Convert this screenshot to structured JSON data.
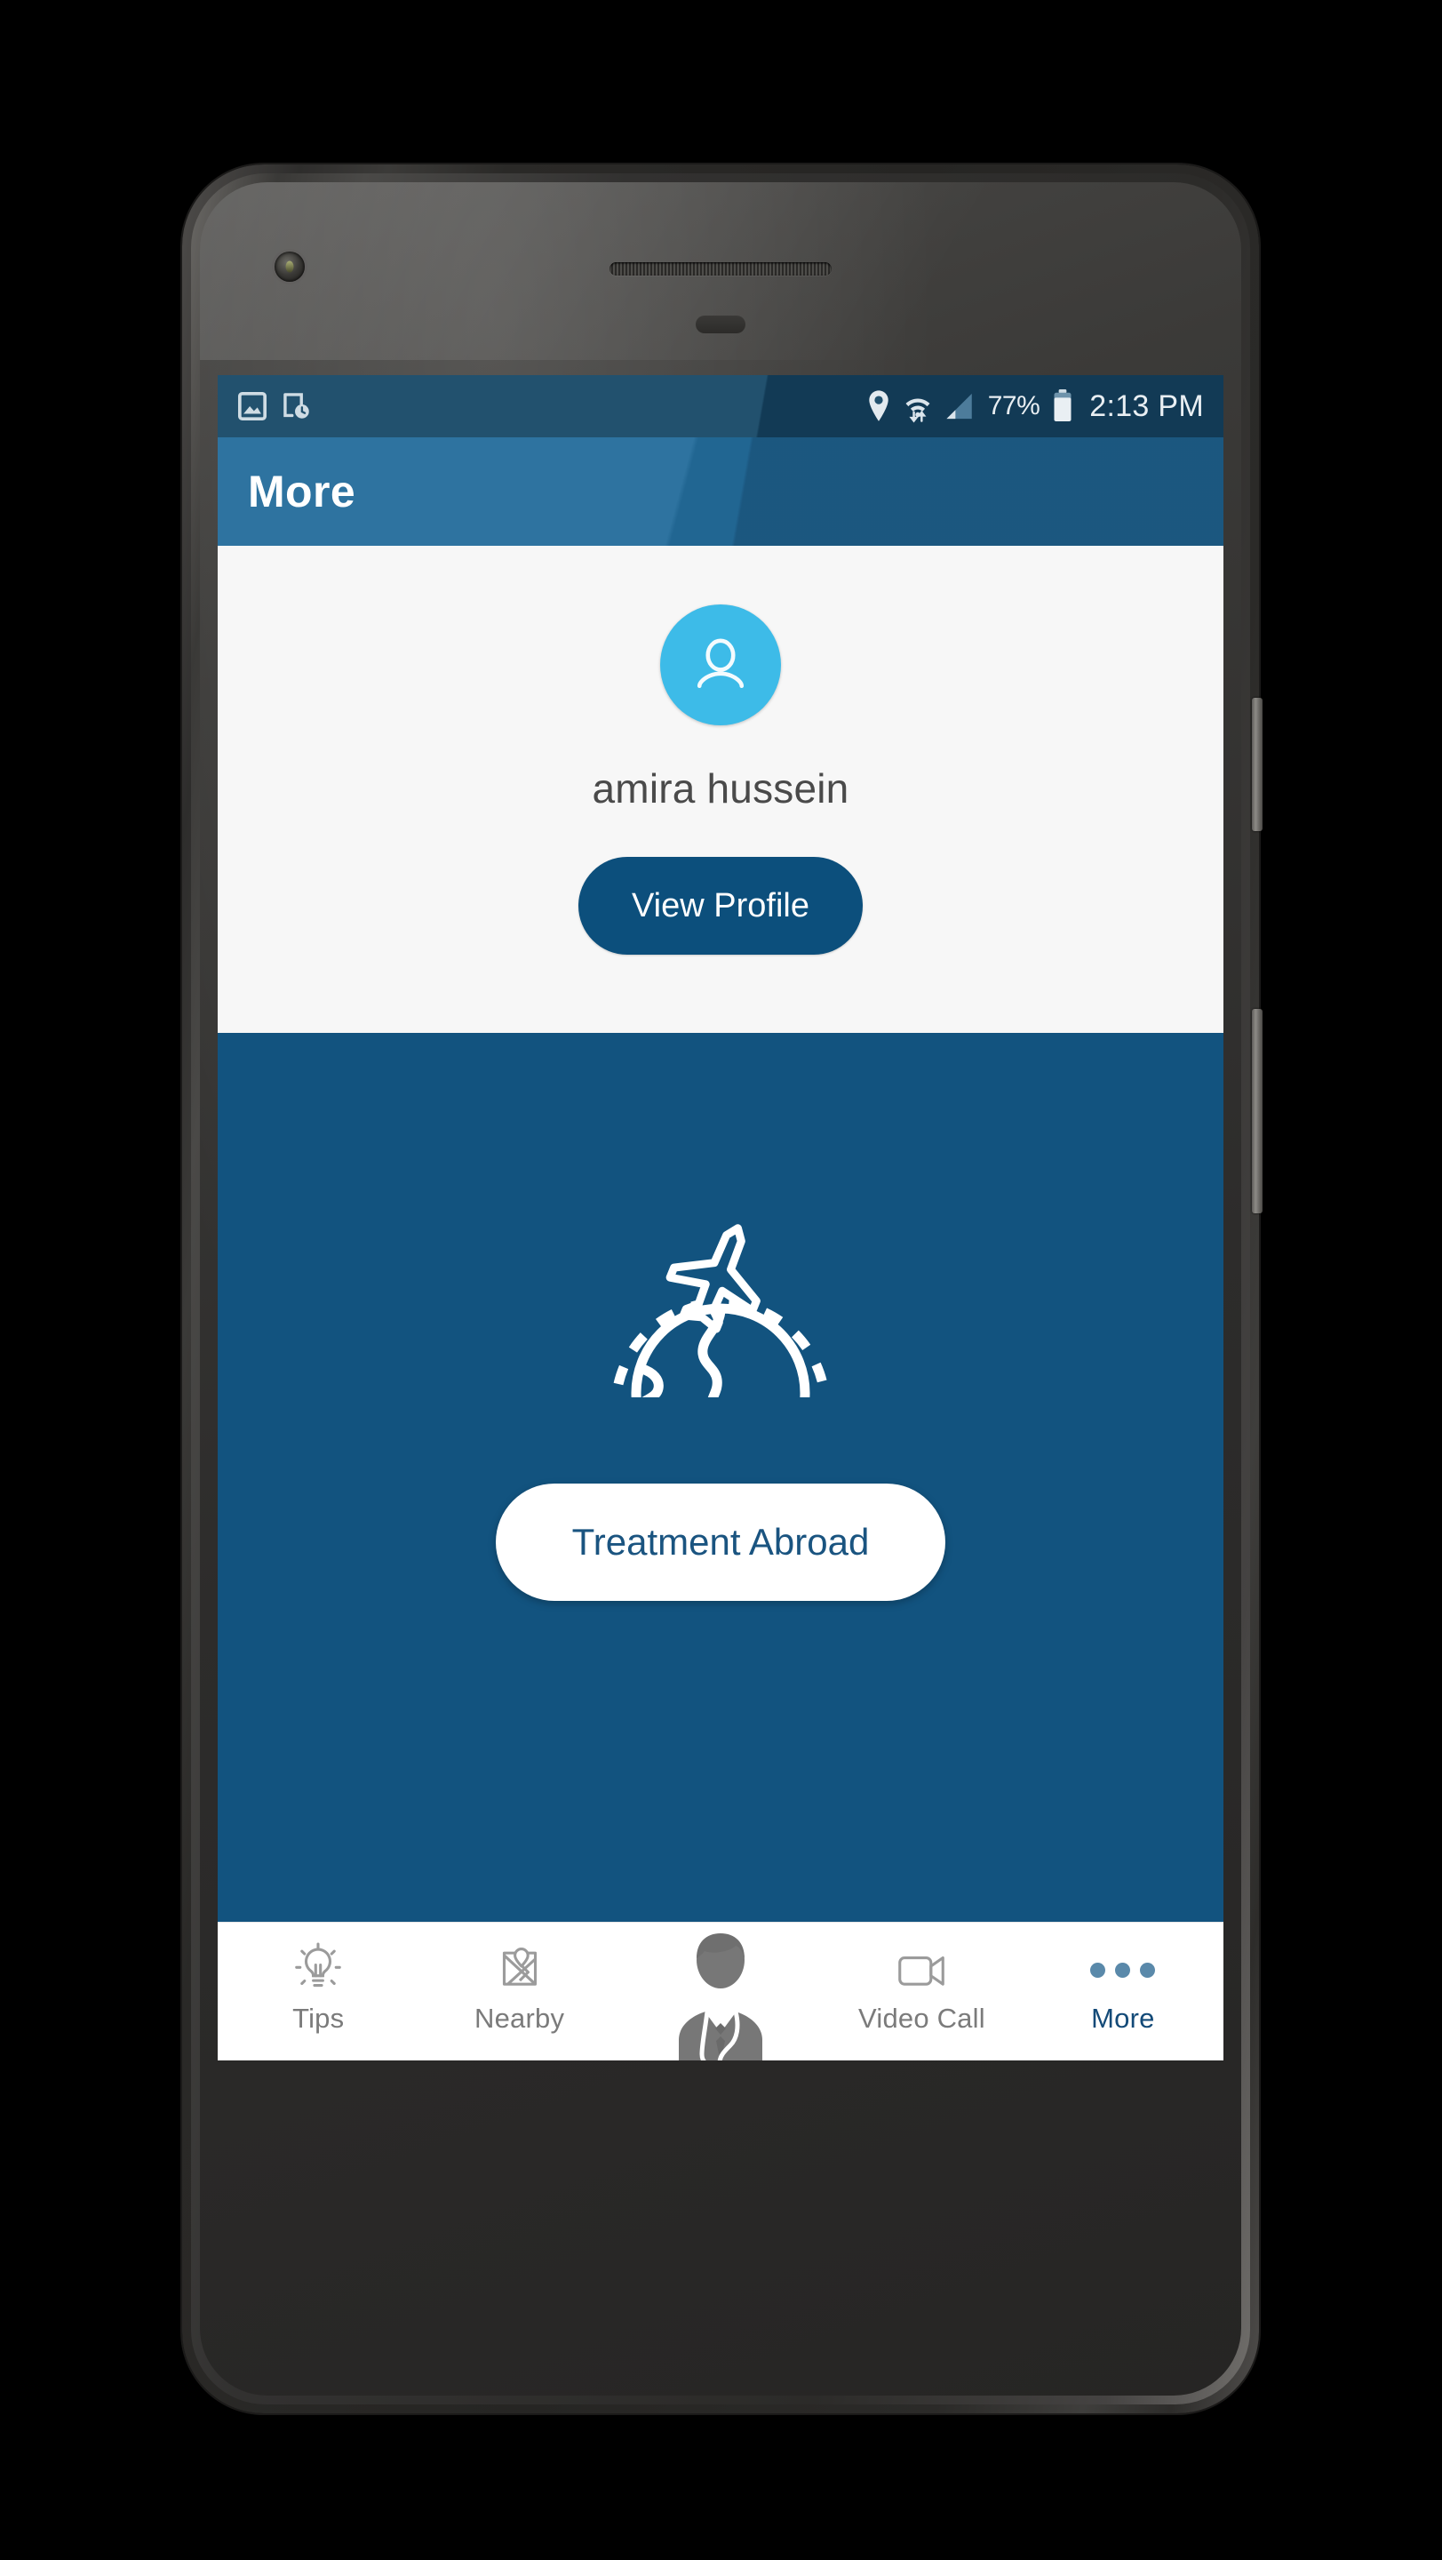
{
  "statusbar": {
    "left_icons": [
      "image-icon",
      "device-clock-icon"
    ],
    "right_icons": [
      "location-pin-icon",
      "wifi-icon",
      "cellular-signal-icon"
    ],
    "battery_percent": "77%",
    "battery_icon": "battery-icon",
    "time": "2:13 PM"
  },
  "appbar": {
    "title": "More"
  },
  "profile": {
    "avatar_icon": "person-avatar-icon",
    "name": "amira hussein",
    "view_profile_label": "View Profile"
  },
  "abroad": {
    "art_icon": "airplane-over-globe-icon",
    "button_label": "Treatment Abroad"
  },
  "bottomnav": {
    "items": [
      {
        "label": "Tips",
        "icon": "lightbulb-icon",
        "active": false
      },
      {
        "label": "Nearby",
        "icon": "map-pin-icon",
        "active": false
      },
      {
        "label": "",
        "icon": "doctor-icon",
        "active": false
      },
      {
        "label": "Video Call",
        "icon": "video-camera-icon",
        "active": false
      },
      {
        "label": "More",
        "icon": "three-dots-icon",
        "active": true
      }
    ]
  },
  "colors": {
    "statusbar_bg": "#22516e",
    "appbar_bg": "#236c9b",
    "card_bg": "#f7f7f7",
    "avatar_bg": "#3dbbe8",
    "primary_button": "#0c4f7c",
    "abroad_bg": "#12537f",
    "abroad_button_text": "#1a5480",
    "active_nav": "#134a78",
    "inactive_nav": "#7b7b7b"
  }
}
